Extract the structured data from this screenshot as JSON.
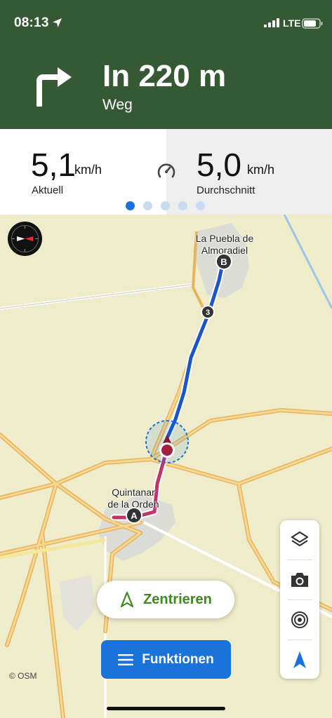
{
  "status_bar": {
    "time": "08:13",
    "network": "LTE"
  },
  "navigation": {
    "distance": "In 220 m",
    "street": "Weg",
    "maneuver_icon": "turn-right-arrow-icon"
  },
  "stats": {
    "current": {
      "value": "5,1",
      "unit": "km/h",
      "label": "Aktuell"
    },
    "average": {
      "value": "5,0",
      "unit": "km/h",
      "label": "Durchschnitt"
    },
    "page_count": 5,
    "active_page": 1
  },
  "map": {
    "place_top": "La Puebla de\nAlmoradiel",
    "place_bottom": "Quintanar\nde la Orden",
    "marker_start": "A",
    "marker_end": "B",
    "waypoint": "3",
    "attribution": "© OSM"
  },
  "buttons": {
    "center": "Zentrieren",
    "functions": "Funktionen"
  },
  "colors": {
    "header": "#355a33",
    "accent": "#1a73d9",
    "route": "#1a55c9",
    "route_done": "#c2336a",
    "center_text": "#3d8a1f"
  }
}
